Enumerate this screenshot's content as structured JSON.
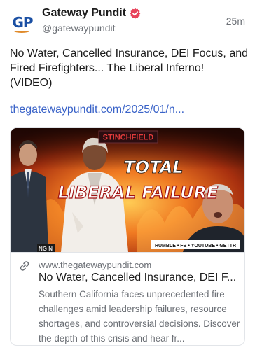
{
  "author": {
    "avatar_text": "GP",
    "display_name": "Gateway Pundit",
    "handle": "@gatewaypundit",
    "time": "25m",
    "verified_icon": "verified-badge-icon"
  },
  "post": {
    "text": "No Water, Cancelled Insurance, DEI Focus, and Fired Firefighters... The Liberal Inferno! (VIDEO)",
    "link_text": "thegatewaypundit.com/2025/01/n..."
  },
  "card": {
    "image": {
      "brand": "STINCHFIELD",
      "headline_line1": "TOTAL",
      "headline_line2": "LIBERAL FAILURE",
      "platforms": "RUMBLE • FB • YOUTUBE • GETTR",
      "corner_text": "NG N"
    },
    "domain": "www.thegatewaypundit.com",
    "title": "No Water, Cancelled Insurance, DEI F...",
    "description": "Southern California faces unprecedented fire challenges amid leadership failures, resource shortages, and controversial decisions. Discover the depth of this crisis and hear fr..."
  },
  "colors": {
    "link": "#3a63c8",
    "verified": "#e8425a",
    "brand_blue": "#1a4fa3",
    "fire": "#e0501c"
  }
}
